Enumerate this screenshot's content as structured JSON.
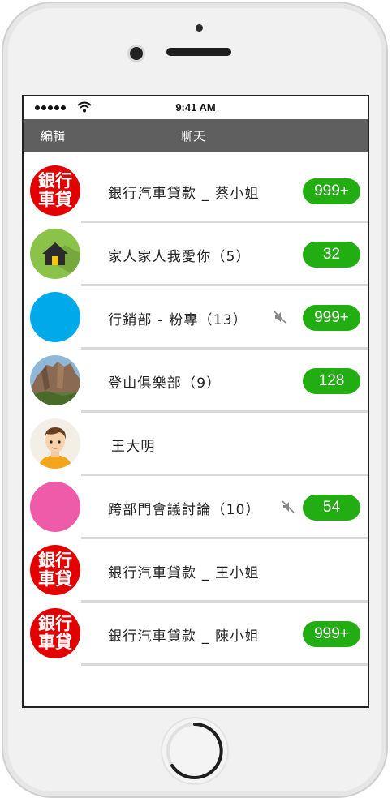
{
  "status_bar": {
    "time": "9:41 AM"
  },
  "nav": {
    "edit_label": "編輯",
    "title": "聊天"
  },
  "bank_logo": {
    "line1": "銀行",
    "line2": "車貸"
  },
  "chats": [
    {
      "name": "銀行汽車貸款 _ 蔡小姐",
      "badge": "999+",
      "avatar": "bank-logo",
      "muted": false
    },
    {
      "name": "家人家人我愛你（5）",
      "badge": "32",
      "avatar": "home-icon",
      "muted": false
    },
    {
      "name": "行銷部 - 粉專（13）",
      "badge": "999+",
      "avatar": "blue-circle",
      "muted": true
    },
    {
      "name": "登山俱樂部（9）",
      "badge": "128",
      "avatar": "mountain-photo",
      "muted": false
    },
    {
      "name": "王大明",
      "badge": "",
      "avatar": "man-portrait",
      "muted": false
    },
    {
      "name": "跨部門會議討論（10）",
      "badge": "54",
      "avatar": "pink-circle",
      "muted": true
    },
    {
      "name": "銀行汽車貸款 _ 王小姐",
      "badge": "",
      "avatar": "bank-logo",
      "muted": false
    },
    {
      "name": "銀行汽車貸款 _ 陳小姐",
      "badge": "999+",
      "avatar": "bank-logo",
      "muted": false
    }
  ],
  "colors": {
    "navbar": "#5f5f5f",
    "badge": "#22ad13",
    "bank": "#e30000",
    "blue": "#00a9ea",
    "pink": "#ee5ba8",
    "home_green": "#8bc34a"
  }
}
